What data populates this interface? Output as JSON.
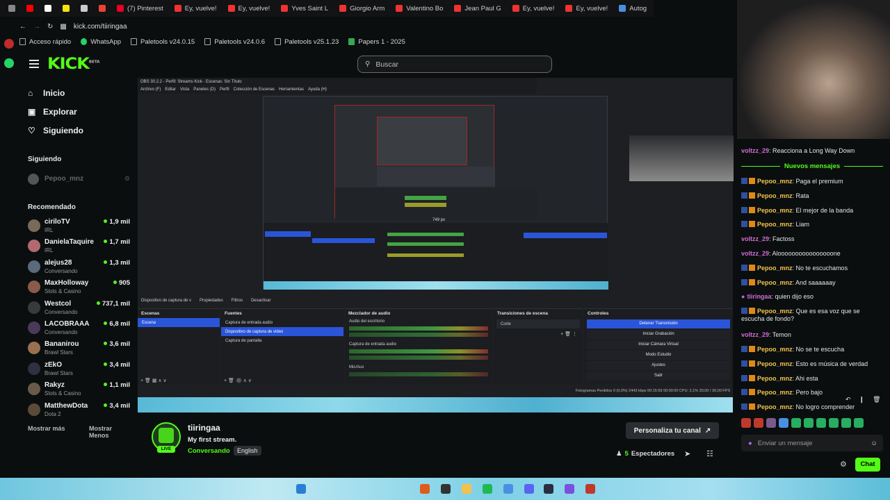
{
  "browser": {
    "tabs": [
      {
        "label": "",
        "color": "#888888"
      },
      {
        "label": "",
        "color": "#ff0000"
      },
      {
        "label": "",
        "color": "#ffffff"
      },
      {
        "label": "",
        "color": "#f5e20c"
      },
      {
        "label": "",
        "color": "#cccccc"
      },
      {
        "label": "",
        "color": "#ea4335"
      },
      {
        "label": "(7) Pinterest",
        "color": "#e60023"
      },
      {
        "label": "Ey, vuelve!",
        "color": "#e33"
      },
      {
        "label": "Ey, vuelve!",
        "color": "#e33"
      },
      {
        "label": "Yves Saint L",
        "color": "#e33"
      },
      {
        "label": "Giorgio Arm",
        "color": "#e33"
      },
      {
        "label": "Valentino Bo",
        "color": "#e33"
      },
      {
        "label": "Jean Paul G",
        "color": "#e33"
      },
      {
        "label": "Ey, vuelve!",
        "color": "#e33"
      },
      {
        "label": "Ey, vuelve!",
        "color": "#e33"
      },
      {
        "label": "Autog",
        "color": "#4a90e2"
      }
    ],
    "url": "kick.com/tiiringaa",
    "bookmarks": [
      {
        "label": "Acceso rápido"
      },
      {
        "label": "WhatsApp"
      },
      {
        "label": "Paletools v24.0.15"
      },
      {
        "label": "Paletools v24.0.6"
      },
      {
        "label": "Paletools v25.1.23"
      },
      {
        "label": "Papers 1 - 2025"
      }
    ]
  },
  "header": {
    "logo": "KICK",
    "logo_tag": "BETA",
    "search_placeholder": "Buscar"
  },
  "nav": {
    "items": [
      {
        "label": "Inicio",
        "icon": "home-icon"
      },
      {
        "label": "Explorar",
        "icon": "compass-icon"
      },
      {
        "label": "Siguiendo",
        "icon": "heart-icon"
      }
    ],
    "following_title": "Siguiendo",
    "following": [
      {
        "name": "Pepoo_mnz"
      }
    ],
    "recommended_title": "Recomendado",
    "recommended": [
      {
        "name": "ciriloTV",
        "category": "IRL",
        "viewers": "1,9 mil",
        "color": "#7a6a5a"
      },
      {
        "name": "DanielaTaquire",
        "category": "IRL",
        "viewers": "1,7 mil",
        "color": "#b06a70"
      },
      {
        "name": "alejus28",
        "category": "Conversando",
        "viewers": "1,3 mil",
        "color": "#5a6a7a"
      },
      {
        "name": "MaxHolloway",
        "category": "Slots & Casino",
        "viewers": "905",
        "color": "#8a5a4a"
      },
      {
        "name": "Westcol",
        "category": "Conversando",
        "viewers": "737,1 mil",
        "color": "#3a3a3a"
      },
      {
        "name": "LACOBRAAA",
        "category": "Conversando",
        "viewers": "6,8 mil",
        "color": "#4a3a5a"
      },
      {
        "name": "Bananirou",
        "category": "Brawl Stars",
        "viewers": "3,6 mil",
        "color": "#9a7050"
      },
      {
        "name": "zEkO",
        "category": "Brawl Stars",
        "viewers": "3,4 mil",
        "color": "#303040"
      },
      {
        "name": "Rakyz",
        "category": "Slots & Casino",
        "viewers": "1,1 mil",
        "color": "#6a5a4a"
      },
      {
        "name": "MatthewDota",
        "category": "Dota 2",
        "viewers": "3,4 mil",
        "color": "#5a4a3a"
      }
    ],
    "show_more": "Mostrar más",
    "show_less": "Mostrar Menos"
  },
  "obs": {
    "title": "OBS 30.2.2 - Perfil: Streams Kick - Escenas: Sin Título",
    "menu": [
      "Archivo (F)",
      "Editar",
      "Vista",
      "Paneles (D)",
      "Perfil",
      "Colección de Escenas",
      "Herramientas",
      "Ayuda (H)"
    ],
    "source_toolbar": [
      "Dispositivo de captura de v",
      "Propiedades",
      "Filtros",
      "Desactivar"
    ],
    "scenes_title": "Escenas",
    "scenes": [
      "Escena"
    ],
    "sources_title": "Fuentes",
    "sources": [
      "Captura de entrada audio",
      "Dispositivo de captura de video",
      "Captura de pantalla"
    ],
    "mixer_title": "Mezclador de audio",
    "mixer": [
      "Audio del escritorio",
      "Captura de entrada audio",
      "Mic/Aux"
    ],
    "transitions_title": "Transiciones de escena",
    "transition": "Corte",
    "controls_title": "Controles",
    "controls": [
      "Detener Transmisión",
      "Iniciar Grabación",
      "Iniciar Cámara Virtual",
      "Modo Estudio",
      "Ajustes",
      "Salir"
    ],
    "status": "Fotogramas Perdidos 0 (0,0%)   2443 kbps   00:15:59   00:00:00   CPU: 2,1%   30,00 / 30,00 FPS"
  },
  "chat": {
    "new_messages": "Nuevos mensajes",
    "messages": [
      {
        "user": "voltzz_29",
        "text": "Reacciona a Long Way Down",
        "badge": false
      },
      {
        "user": "Pepoo_mnz",
        "text": "Paga el premium",
        "badge": true
      },
      {
        "user": "Pepoo_mnz",
        "text": "Rata",
        "badge": true
      },
      {
        "user": "Pepoo_mnz",
        "text": "El mejor de la banda",
        "badge": true
      },
      {
        "user": "Pepoo_mnz",
        "text": "Liam",
        "badge": true
      },
      {
        "user": "voltzz_29",
        "text": "Factoss",
        "badge": false
      },
      {
        "user": "voltzz_29",
        "text": "Aloooooooooooooooone",
        "badge": false
      },
      {
        "user": "Pepoo_mnz",
        "text": "No te escuchamos",
        "badge": true
      },
      {
        "user": "Pepoo_mnz",
        "text": "And saaaaaay",
        "badge": true
      },
      {
        "user": "tiiringaa",
        "text": "quien dijo eso",
        "badge": false
      },
      {
        "user": "Pepoo_mnz",
        "text": "Que es esa voz que se escucha de fondo?",
        "badge": true
      },
      {
        "user": "voltzz_29",
        "text": "Temon",
        "badge": false
      },
      {
        "user": "Pepoo_mnz",
        "text": "No se te escucha",
        "badge": true
      },
      {
        "user": "Pepoo_mnz",
        "text": "Esto es música de verdad",
        "badge": true
      },
      {
        "user": "Pepoo_mnz",
        "text": "Ahi esta",
        "badge": true
      },
      {
        "user": "Pepoo_mnz",
        "text": "Pero bajo",
        "badge": true
      },
      {
        "user": "Pepoo_mnz",
        "text": "No logro comprender",
        "badge": true
      }
    ],
    "input_placeholder": "Enviar un mensaje",
    "send_button": "Chat"
  },
  "stream": {
    "channel": "tiiringaa",
    "title": "My first stream.",
    "category": "Conversando",
    "language": "English",
    "live_badge": "LIVE",
    "viewers_count": "5",
    "viewers_label": "Espectadores",
    "customize_button": "Personaliza tu canal"
  }
}
